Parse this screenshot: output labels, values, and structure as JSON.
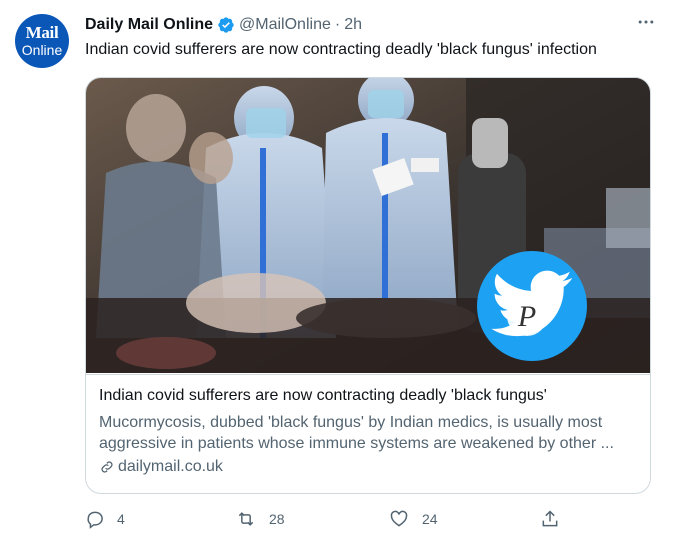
{
  "account": {
    "avatar_line1": "Mail",
    "avatar_line2": "Online",
    "name": "Daily Mail Online",
    "handle": "@MailOnline",
    "separator": "·",
    "time": "2h"
  },
  "tweet": {
    "text": "Indian covid sufferers are now contracting deadly 'black fungus' infection"
  },
  "link_card": {
    "image_badge_letter": "P",
    "title": "Indian covid sufferers are now contracting deadly 'black fungus'",
    "description": "Mucormycosis, dubbed 'black fungus' by Indian medics, is usually most aggressive in patients whose immune systems are weakened by other ...",
    "domain": "dailymail.co.uk"
  },
  "actions": {
    "replies": "4",
    "retweets": "28",
    "likes": "24"
  },
  "colors": {
    "verified_blue": "#1d9bf0",
    "text_primary": "#0f1419",
    "text_secondary": "#536471",
    "border": "#cfd9de",
    "avatar_blue": "#0b57b8"
  },
  "icons": [
    "verified-badge-icon",
    "more-icon",
    "link-icon",
    "reply-icon",
    "retweet-icon",
    "like-icon",
    "share-icon",
    "twitter-bird-icon"
  ]
}
